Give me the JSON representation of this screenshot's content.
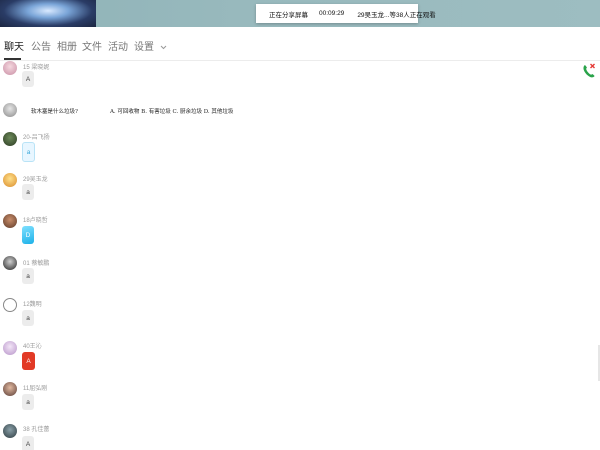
{
  "share_bar": {
    "status": "正在分享屏幕",
    "timer": "00:09:29",
    "viewers": "29吴玉龙...等38人正在观看"
  },
  "tabs": [
    {
      "label": "聊天",
      "active": true
    },
    {
      "label": "公告",
      "active": false
    },
    {
      "label": "相册",
      "active": false
    },
    {
      "label": "文件",
      "active": false
    },
    {
      "label": "活动",
      "active": false
    },
    {
      "label": "设置",
      "active": false
    }
  ],
  "icons": {
    "settings_dropdown": "chevron-down-icon",
    "call": "phone-call-icon"
  },
  "question": {
    "text": "软木塞是什么垃圾?",
    "options": "A. 可回收物 B. 有害垃圾 C. 厨余垃圾 D. 其他垃圾"
  },
  "messages": [
    {
      "sender": "15 梁晓妮",
      "content": "A"
    },
    {
      "sender": "20-吕飞扬",
      "content": "a"
    },
    {
      "sender": "29吴玉龙",
      "content": "a"
    },
    {
      "sender": "18卢晓哲",
      "content": "D"
    },
    {
      "sender": "01 蔡敏鹏",
      "content": "a"
    },
    {
      "sender": "12魏明",
      "content": "a"
    },
    {
      "sender": "40王沁",
      "content": "A"
    },
    {
      "sender": "11屈弘刚",
      "content": "a"
    },
    {
      "sender": "38 孔佳蕾",
      "content": "A"
    }
  ],
  "colors": {
    "active_tab": "#222222",
    "call_icon_green": "#2aa34a",
    "call_icon_red": "#e53935"
  }
}
